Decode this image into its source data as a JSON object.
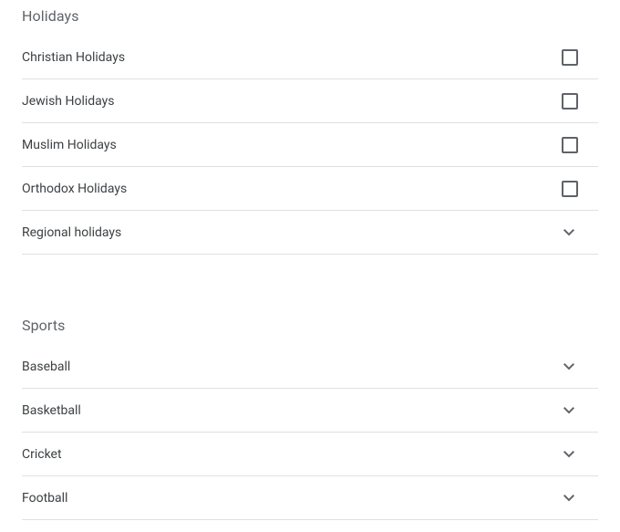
{
  "sections": {
    "holidays": {
      "title": "Holidays",
      "items": [
        {
          "label": "Christian Holidays",
          "type": "checkbox"
        },
        {
          "label": "Jewish Holidays",
          "type": "checkbox"
        },
        {
          "label": "Muslim Holidays",
          "type": "checkbox"
        },
        {
          "label": "Orthodox Holidays",
          "type": "checkbox"
        },
        {
          "label": "Regional holidays",
          "type": "expand"
        }
      ]
    },
    "sports": {
      "title": "Sports",
      "items": [
        {
          "label": "Baseball",
          "type": "expand"
        },
        {
          "label": "Basketball",
          "type": "expand"
        },
        {
          "label": "Cricket",
          "type": "expand"
        },
        {
          "label": "Football",
          "type": "expand"
        }
      ]
    }
  }
}
